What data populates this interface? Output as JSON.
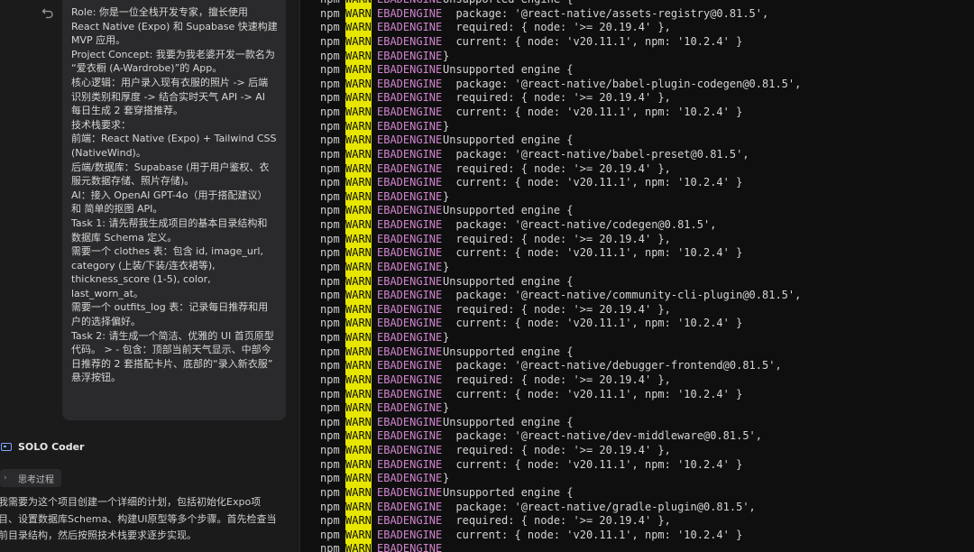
{
  "chat": {
    "user_prompt": [
      "Role: 你是一位全栈开发专家，擅长使用",
      "React Native (Expo) 和 Supabase 快速构建",
      "MVP 应用。",
      "Project Concept: 我要为我老婆开发一款名为",
      "“爱衣橱 (A-Wardrobe)”的 App。",
      "核心逻辑：用户录入现有衣服的照片 -> 后端",
      "识别类别和厚度 -> 结合实时天气 API -> AI",
      "每日生成 2 套穿搭推荐。",
      "技术栈要求：",
      "前端：React Native (Expo) + Tailwind CSS",
      "(NativeWind)。",
      "后端/数据库：Supabase (用于用户鉴权、衣",
      "服元数据存储、照片存储)。",
      "AI：接入 OpenAI GPT-4o（用于搭配建议）",
      "和 简单的抠图 API。",
      "Task 1: 请先帮我生成项目的基本目录结构和",
      "数据库 Schema 定义。",
      "需要一个 clothes 表：包含 id, image_url,",
      "category (上装/下装/连衣裙等),",
      "thickness_score (1-5), color, last_worn_at。",
      "需要一个 outfits_log 表：记录每日推荐和用",
      "户的选择偏好。",
      "Task 2: 请生成一个简洁、优雅的 UI 首页原型",
      "代码。 > - 包含：顶部当前天气显示、中部今",
      "日推荐的 2 套搭配卡片、底部的“录入新衣服”",
      "悬浮按钮。"
    ],
    "agent_name": "SOLO Coder",
    "thought_label": "思考过程",
    "agent_text": [
      "我需要为这个项目创建一个详细的计划，包括初始化Expo项",
      "目、设置数据库Schema、构建UI原型等多个步骤。首先检查当",
      "前目录结构，然后按照技术栈要求逐步实现。"
    ]
  },
  "terminal": {
    "lines": [
      {
        "c": "EBADENGINE",
        "m": "Unsupported engine {"
      },
      {
        "c": "EBADENGINE",
        "m": "  package: '@react-native/assets-registry@0.81.5',"
      },
      {
        "c": "EBADENGINE",
        "m": "  required: { node: '>= 20.19.4' },"
      },
      {
        "c": "EBADENGINE",
        "m": "  current: { node: 'v20.11.1', npm: '10.2.4' }"
      },
      {
        "c": "EBADENGINE",
        "m": "}"
      },
      {
        "c": "EBADENGINE",
        "m": "Unsupported engine {"
      },
      {
        "c": "EBADENGINE",
        "m": "  package: '@react-native/babel-plugin-codegen@0.81.5',"
      },
      {
        "c": "EBADENGINE",
        "m": "  required: { node: '>= 20.19.4' },"
      },
      {
        "c": "EBADENGINE",
        "m": "  current: { node: 'v20.11.1', npm: '10.2.4' }"
      },
      {
        "c": "EBADENGINE",
        "m": "}"
      },
      {
        "c": "EBADENGINE",
        "m": "Unsupported engine {"
      },
      {
        "c": "EBADENGINE",
        "m": "  package: '@react-native/babel-preset@0.81.5',"
      },
      {
        "c": "EBADENGINE",
        "m": "  required: { node: '>= 20.19.4' },"
      },
      {
        "c": "EBADENGINE",
        "m": "  current: { node: 'v20.11.1', npm: '10.2.4' }"
      },
      {
        "c": "EBADENGINE",
        "m": "}"
      },
      {
        "c": "EBADENGINE",
        "m": "Unsupported engine {"
      },
      {
        "c": "EBADENGINE",
        "m": "  package: '@react-native/codegen@0.81.5',"
      },
      {
        "c": "EBADENGINE",
        "m": "  required: { node: '>= 20.19.4' },"
      },
      {
        "c": "EBADENGINE",
        "m": "  current: { node: 'v20.11.1', npm: '10.2.4' }"
      },
      {
        "c": "EBADENGINE",
        "m": "}"
      },
      {
        "c": "EBADENGINE",
        "m": "Unsupported engine {"
      },
      {
        "c": "EBADENGINE",
        "m": "  package: '@react-native/community-cli-plugin@0.81.5',"
      },
      {
        "c": "EBADENGINE",
        "m": "  required: { node: '>= 20.19.4' },"
      },
      {
        "c": "EBADENGINE",
        "m": "  current: { node: 'v20.11.1', npm: '10.2.4' }"
      },
      {
        "c": "EBADENGINE",
        "m": "}"
      },
      {
        "c": "EBADENGINE",
        "m": "Unsupported engine {"
      },
      {
        "c": "EBADENGINE",
        "m": "  package: '@react-native/debugger-frontend@0.81.5',"
      },
      {
        "c": "EBADENGINE",
        "m": "  required: { node: '>= 20.19.4' },"
      },
      {
        "c": "EBADENGINE",
        "m": "  current: { node: 'v20.11.1', npm: '10.2.4' }"
      },
      {
        "c": "EBADENGINE",
        "m": "}"
      },
      {
        "c": "EBADENGINE",
        "m": "Unsupported engine {"
      },
      {
        "c": "EBADENGINE",
        "m": "  package: '@react-native/dev-middleware@0.81.5',"
      },
      {
        "c": "EBADENGINE",
        "m": "  required: { node: '>= 20.19.4' },"
      },
      {
        "c": "EBADENGINE",
        "m": "  current: { node: 'v20.11.1', npm: '10.2.4' }"
      },
      {
        "c": "EBADENGINE",
        "m": "}"
      },
      {
        "c": "EBADENGINE",
        "m": "Unsupported engine {"
      },
      {
        "c": "EBADENGINE",
        "m": "  package: '@react-native/gradle-plugin@0.81.5',"
      },
      {
        "c": "EBADENGINE",
        "m": "  required: { node: '>= 20.19.4' },"
      },
      {
        "c": "EBADENGINE",
        "m": "  current: { node: 'v20.11.1', npm: '10.2.4' }"
      },
      {
        "c": "EBADENGINE",
        "m": ""
      }
    ],
    "prefix": "npm",
    "level": "WARN",
    "warn_bg": "#e6e600",
    "code_color": "#d084cc"
  }
}
